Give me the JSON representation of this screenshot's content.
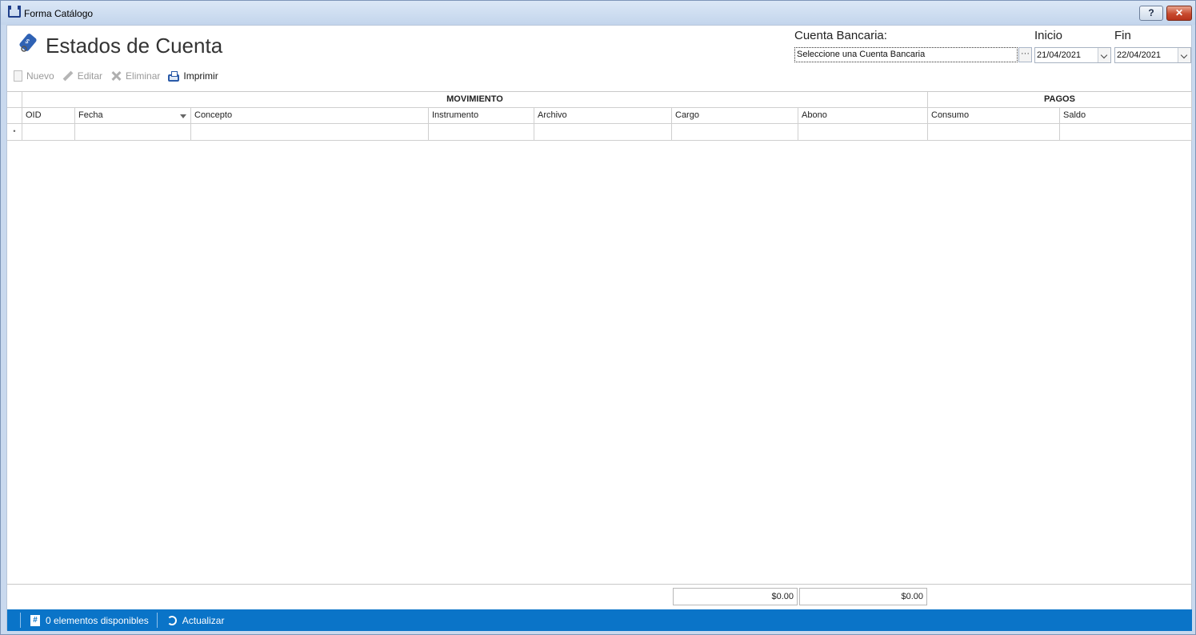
{
  "window": {
    "title": "Forma Catálogo",
    "help_label": "?",
    "close_label": "✕"
  },
  "page": {
    "title": "Estados de Cuenta"
  },
  "toolbar": {
    "new_label": "Nuevo",
    "edit_label": "Editar",
    "delete_label": "Eliminar",
    "print_label": "Imprimir"
  },
  "filters": {
    "account_label": "Cuenta Bancaria:",
    "account_value": "Seleccione una Cuenta Bancaria",
    "ellipsis_label": "···",
    "start_label": "Inicio",
    "start_value": "21/04/2021",
    "end_label": "Fin",
    "end_value": "22/04/2021"
  },
  "grid": {
    "bands": [
      "MOVIMIENTO",
      "PAGOS"
    ],
    "columns": [
      "OID",
      "Fecha",
      "Concepto",
      "Instrumento",
      "Archivo",
      "Cargo",
      "Abono",
      "Consumo",
      "Saldo"
    ],
    "new_row_indicator": "•"
  },
  "totals": {
    "cargo": "$0.00",
    "abono": "$0.00"
  },
  "status": {
    "items_count_label": "0 elementos disponibles",
    "refresh_label": "Actualizar",
    "hash_glyph": "#"
  },
  "colors": {
    "accent": "#0a74c8",
    "close": "#c74a2e"
  }
}
